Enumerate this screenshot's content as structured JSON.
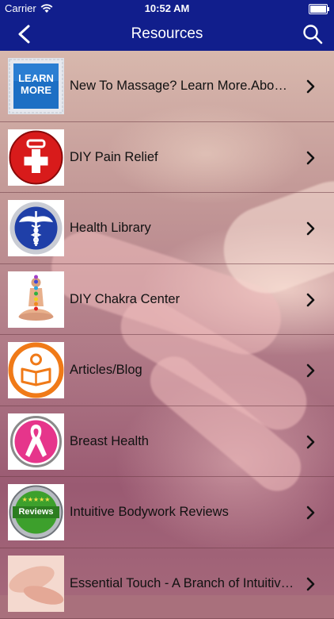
{
  "status": {
    "carrier": "Carrier",
    "time": "10:52 AM"
  },
  "nav": {
    "title": "Resources",
    "back_icon": "chevron-left-icon",
    "search_icon": "search-icon"
  },
  "colors": {
    "nav_bg": "#111e8c",
    "text": "#111111"
  },
  "items": [
    {
      "label": "New To Massage? Learn More.About Massage",
      "icon": "learn-more-icon",
      "thumb_text": "LEARN MORE"
    },
    {
      "label": "DIY Pain Relief",
      "icon": "first-aid-kit-icon"
    },
    {
      "label": "Health Library",
      "icon": "caduceus-icon"
    },
    {
      "label": "DIY Chakra Center",
      "icon": "chakra-figure-icon"
    },
    {
      "label": "Articles/Blog",
      "icon": "reader-icon"
    },
    {
      "label": "Breast Health",
      "icon": "pink-ribbon-icon"
    },
    {
      "label": "Intuitive Bodywork Reviews",
      "icon": "reviews-badge-icon",
      "thumb_text": "Reviews"
    },
    {
      "label": "Essential Touch - A Branch of Intuitive Bodywork",
      "icon": "hand-massage-photo-icon"
    }
  ]
}
